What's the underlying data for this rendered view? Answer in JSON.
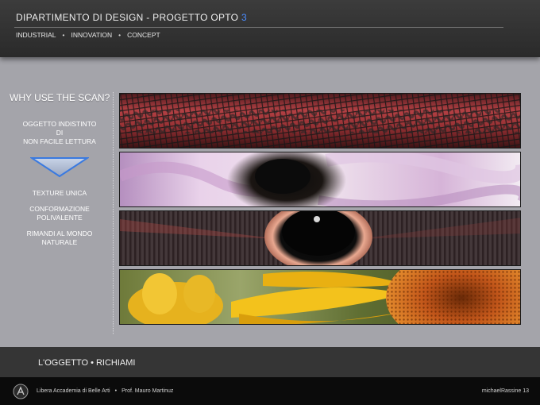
{
  "header": {
    "title": "DIPARTIMENTO DI DESIGN  -  PROGETTO OPTO",
    "title_number": "3",
    "subnav": [
      "INDUSTRIAL",
      "INNOVATION",
      "CONCEPT"
    ],
    "separator": "•"
  },
  "side": {
    "heading": "WHY USE THE SCAN?",
    "block1": [
      "OGGETTO INDISTINTO",
      "DI",
      "NON FACILE LETTURA"
    ],
    "block2": [
      "TEXTURE UNICA"
    ],
    "block3": [
      "CONFORMAZIONE",
      "POLIVALENTE"
    ],
    "block4": [
      "RIMANDI AL MONDO",
      "NATURALE"
    ],
    "arrow_icon": "down-triangle-icon"
  },
  "strips": [
    {
      "name": "red-mesh-scan",
      "icon": "texture-image"
    },
    {
      "name": "pink-flower-scan",
      "icon": "texture-image"
    },
    {
      "name": "radial-eye-scan",
      "icon": "texture-image"
    },
    {
      "name": "sunflower-scan",
      "icon": "texture-image"
    }
  ],
  "footer": {
    "section_label": "L'OGGETTO • RICHIAMI",
    "academy": "Libera Accademia di Belle Arti",
    "separator": "•",
    "professor": "Prof. Mauro Martinuz",
    "author": "michaelRassine 13"
  },
  "colors": {
    "background": "#a4a4aa",
    "header": "#333333",
    "accent": "#4a8cff",
    "triangle": "#3a7ae0"
  }
}
